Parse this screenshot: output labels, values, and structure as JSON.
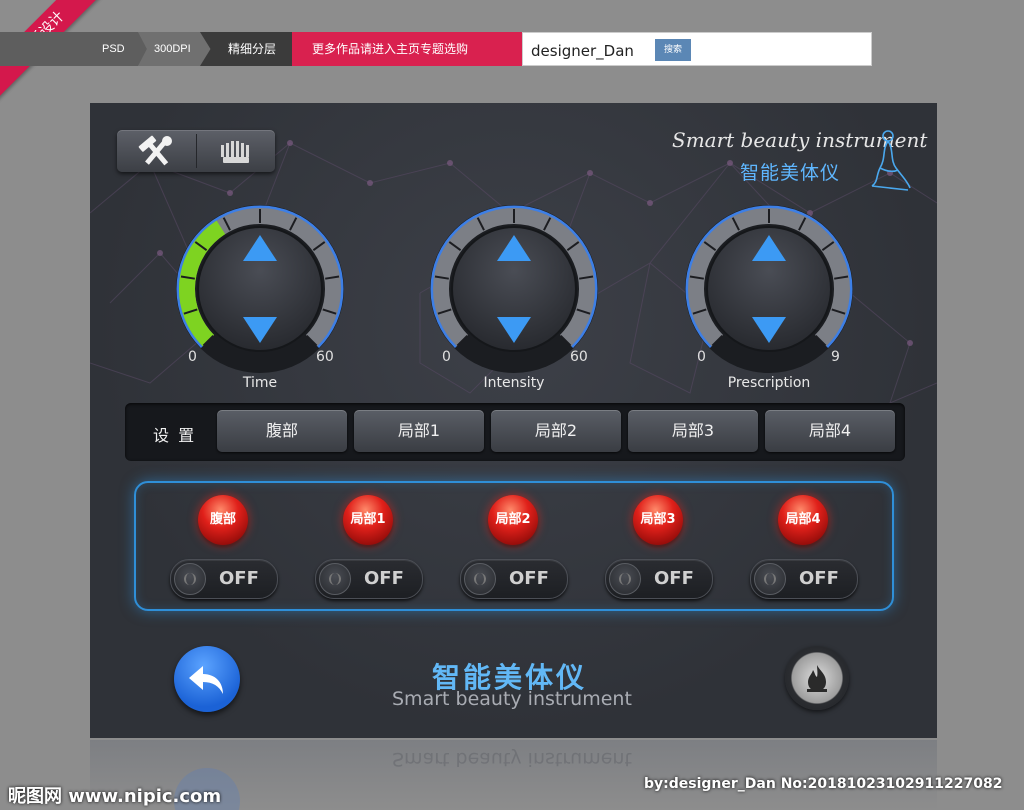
{
  "ribbon": "最新设计",
  "breadcrumbs": [
    "PSD",
    "300DPI",
    "精细分层",
    "更多作品请进入主页专题选购"
  ],
  "search": {
    "value": "designer_Dan",
    "button": "搜索"
  },
  "brand": {
    "en": "Smart beauty instrument",
    "cn": "智能美体仪"
  },
  "toolbar": {
    "left_icon": "tools-icon",
    "right_icon": "heater-icon"
  },
  "dials": [
    {
      "label": "Time",
      "min": "0",
      "max": "60",
      "level": 0.38,
      "color": "#7ed321"
    },
    {
      "label": "Intensity",
      "min": "0",
      "max": "60",
      "level": 0,
      "color": "#3b8be8"
    },
    {
      "label": "Prescription",
      "min": "0",
      "max": "9",
      "level": 0,
      "color": "#3b8be8"
    }
  ],
  "settings": {
    "title": "设 置",
    "segments": [
      "腹部",
      "局部1",
      "局部2",
      "局部3",
      "局部4"
    ]
  },
  "zones": [
    {
      "label": "腹部",
      "state": "OFF"
    },
    {
      "label": "局部1",
      "state": "OFF"
    },
    {
      "label": "局部2",
      "state": "OFF"
    },
    {
      "label": "局部3",
      "state": "OFF"
    },
    {
      "label": "局部4",
      "state": "OFF"
    }
  ],
  "footer": {
    "cn": "智能美体仪",
    "en": "Smart beauty instrument"
  },
  "watermark": {
    "left": "昵图网 www.nipic.com",
    "right": "by:designer_Dan No:20181023102911227082"
  }
}
